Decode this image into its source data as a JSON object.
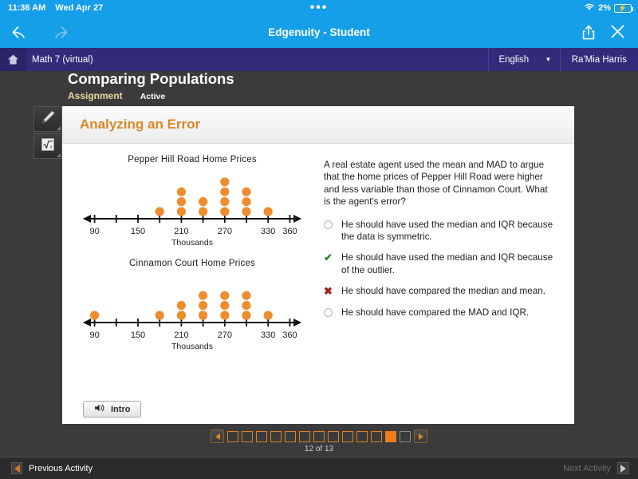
{
  "statusbar": {
    "time": "11:36 AM",
    "date": "Wed Apr 27",
    "dots": "•••",
    "battery_percent": "2%"
  },
  "browser": {
    "title": "Edgenuity - Student",
    "back_icon": "back-arrow-icon",
    "forward_icon": "forward-arrow-icon",
    "share_icon": "share-icon",
    "close_icon": "close-icon"
  },
  "coursebar": {
    "home_icon": "home-icon",
    "course": "Math 7 (virtual)",
    "language": "English",
    "language_caret": "▾",
    "user": "Ra'Mia Harris"
  },
  "lesson": {
    "title": "Comparing Populations",
    "type": "Assignment",
    "status": "Active"
  },
  "tools": [
    {
      "name": "highlighter-tool",
      "icon": "pencil-icon"
    },
    {
      "name": "calculator-tool",
      "icon": "square-root-icon"
    }
  ],
  "card": {
    "heading": "Analyzing an Error",
    "question": "A real estate agent used the mean and MAD to argue that the home prices of Pepper Hill Road were higher and less variable than those of Cinnamon Court. What is the agent's error?",
    "choices": [
      {
        "mark": "radio",
        "text": "He should have used the median and IQR because the data is symmetric."
      },
      {
        "mark": "check",
        "text": "He should have used the median and IQR because of the outlier."
      },
      {
        "mark": "cross",
        "text": "He should have compared the median and mean."
      },
      {
        "mark": "radio",
        "text": "He should have compared the MAD and IQR."
      }
    ]
  },
  "chart_data": [
    {
      "type": "scatter",
      "plot_style": "dot-plot",
      "title": "Pepper Hill Road Home Prices",
      "xlabel": "Thousands",
      "ylabel": "",
      "xlim": [
        75,
        375
      ],
      "tick_step": 30,
      "ticks": [
        90,
        120,
        150,
        180,
        210,
        240,
        270,
        300,
        330,
        360
      ],
      "tick_labels": [
        "90",
        "",
        "150",
        "",
        "210",
        "",
        "270",
        "",
        "330",
        "360"
      ],
      "labeled_ticks": [
        90,
        150,
        210,
        270,
        330,
        360
      ],
      "grid": false,
      "dot_color": "#ee8d2e",
      "x": [
        180,
        210,
        240,
        270,
        300,
        330
      ],
      "counts": [
        1,
        3,
        2,
        4,
        3,
        1
      ],
      "values": [
        180,
        210,
        210,
        210,
        240,
        240,
        270,
        270,
        270,
        270,
        300,
        300,
        300,
        330
      ]
    },
    {
      "type": "scatter",
      "plot_style": "dot-plot",
      "title": "Cinnamon Court Home Prices",
      "xlabel": "Thousands",
      "ylabel": "",
      "xlim": [
        75,
        375
      ],
      "tick_step": 30,
      "ticks": [
        90,
        120,
        150,
        180,
        210,
        240,
        270,
        300,
        330,
        360
      ],
      "tick_labels": [
        "90",
        "",
        "150",
        "",
        "210",
        "",
        "270",
        "",
        "330",
        "360"
      ],
      "labeled_ticks": [
        90,
        150,
        210,
        270,
        330,
        360
      ],
      "grid": false,
      "dot_color": "#ee8d2e",
      "x": [
        90,
        180,
        210,
        240,
        270,
        300,
        330
      ],
      "counts": [
        1,
        1,
        2,
        3,
        3,
        3,
        1
      ],
      "values": [
        90,
        180,
        210,
        210,
        240,
        240,
        240,
        270,
        270,
        270,
        300,
        300,
        300,
        330
      ]
    }
  ],
  "audio": {
    "label": "Intro",
    "icon": "speaker-icon"
  },
  "pager": {
    "prev_icon": "pager-prev-icon",
    "next_icon": "pager-next-icon",
    "total": 13,
    "current": 12,
    "count_label": "12 of 13"
  },
  "bottombar": {
    "previous": "Previous Activity",
    "next": "Next Activity"
  },
  "colors": {
    "ios_blue": "#169fe9",
    "edgenuity_purple": "#332b7a",
    "accent_orange": "#d98827",
    "dot_orange": "#ee8d2e",
    "correct_green": "#2c8a34",
    "wrong_red": "#a02020"
  }
}
